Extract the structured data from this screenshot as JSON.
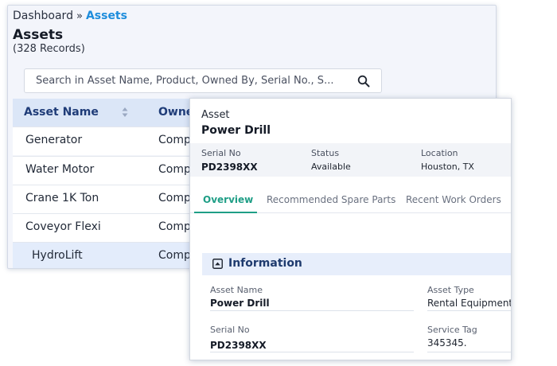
{
  "breadcrumb": {
    "root": "Dashboard",
    "separator": "»",
    "current": "Assets"
  },
  "page": {
    "title": "Assets",
    "record_count": "(328 Records)"
  },
  "search": {
    "placeholder": "Search in Asset Name, Product, Owned By, Serial No., S...",
    "icon": "search-icon"
  },
  "table": {
    "columns": [
      "Asset Name",
      "Owne"
    ],
    "rows": [
      {
        "name": "Generator",
        "owner": "Compa"
      },
      {
        "name": "Water Motor",
        "owner": "Compa"
      },
      {
        "name": "Crane 1K Ton",
        "owner": "Compa"
      },
      {
        "name": "Coveyor Flexi",
        "owner": "Compa"
      },
      {
        "name": "HydroLift",
        "owner": "Compa"
      }
    ]
  },
  "detail": {
    "header_label": "Asset",
    "title": "Power Drill",
    "summary": {
      "serial_label": "Serial No",
      "serial_value": "PD2398XX",
      "status_label": "Status",
      "status_value": "Available",
      "location_label": "Location",
      "location_value": "Houston, TX"
    },
    "tabs": [
      "Overview",
      "Recommended Spare Parts",
      "Recent Work Orders"
    ],
    "active_tab": "Overview",
    "info": {
      "section_title": "Information",
      "asset_name_label": "Asset Name",
      "asset_name_value": "Power Drill",
      "asset_type_label": "Asset Type",
      "asset_type_value": "Rental Equipment",
      "serial_label": "Serial No",
      "serial_value": "PD2398XX",
      "service_tag_label": "Service Tag",
      "service_tag_value": "345345."
    }
  },
  "colors": {
    "accent_blue": "#1e8ddc",
    "accent_teal": "#1f9e86",
    "table_header_bg": "#dbe6f7",
    "selected_row_bg": "#e3ecfb"
  }
}
